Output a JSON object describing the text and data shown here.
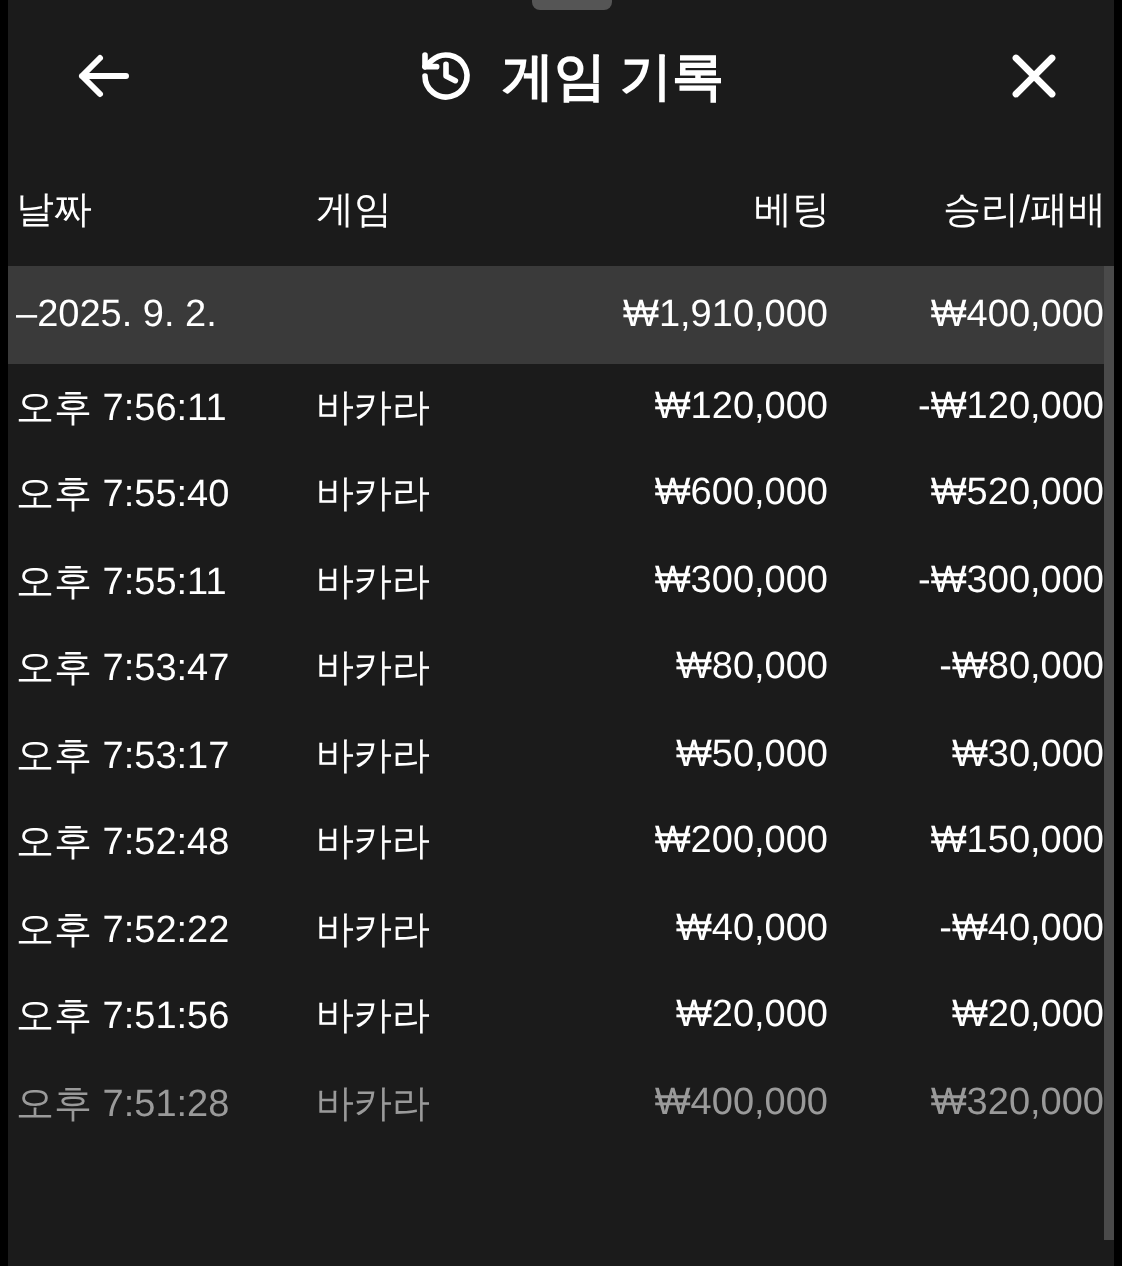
{
  "header": {
    "title": "게임 기록"
  },
  "columns": [
    "날짜",
    "게임",
    "베팅",
    "승리/패배"
  ],
  "group": {
    "date": "–2025. 9. 2.",
    "bet": "₩1,910,000",
    "result": "₩400,000"
  },
  "rows": [
    {
      "time": "오후 7:56:11",
      "game": "바카라",
      "bet": "₩120,000",
      "result": "-₩120,000",
      "dimmed": false
    },
    {
      "time": "오후 7:55:40",
      "game": "바카라",
      "bet": "₩600,000",
      "result": "₩520,000",
      "dimmed": false
    },
    {
      "time": "오후 7:55:11",
      "game": "바카라",
      "bet": "₩300,000",
      "result": "-₩300,000",
      "dimmed": false
    },
    {
      "time": "오후 7:53:47",
      "game": "바카라",
      "bet": "₩80,000",
      "result": "-₩80,000",
      "dimmed": false
    },
    {
      "time": "오후 7:53:17",
      "game": "바카라",
      "bet": "₩50,000",
      "result": "₩30,000",
      "dimmed": false
    },
    {
      "time": "오후 7:52:48",
      "game": "바카라",
      "bet": "₩200,000",
      "result": "₩150,000",
      "dimmed": false
    },
    {
      "time": "오후 7:52:22",
      "game": "바카라",
      "bet": "₩40,000",
      "result": "-₩40,000",
      "dimmed": false
    },
    {
      "time": "오후 7:51:56",
      "game": "바카라",
      "bet": "₩20,000",
      "result": "₩20,000",
      "dimmed": false
    },
    {
      "time": "오후 7:51:28",
      "game": "바카라",
      "bet": "₩400,000",
      "result": "₩320,000",
      "dimmed": true
    }
  ]
}
